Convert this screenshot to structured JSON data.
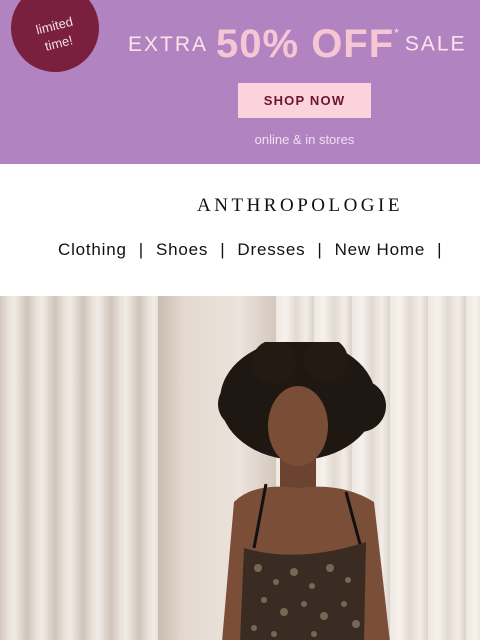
{
  "promo": {
    "badge_line1": "limited",
    "badge_line2": "time!",
    "extra": "EXTRA",
    "discount": "50% OFF",
    "asterisk": "*",
    "sale": "SALE",
    "cta": "SHOP NOW",
    "subline": "online & in stores",
    "colors": {
      "background": "#b184c1",
      "badge": "#7a1f3d",
      "button": "#fbd3dc"
    }
  },
  "brand": {
    "logo": "ANTHROPOLOGIE"
  },
  "nav": {
    "items": [
      {
        "label": "Clothing"
      },
      {
        "label": "Shoes"
      },
      {
        "label": "Dresses"
      },
      {
        "label": "New Home"
      }
    ],
    "separator": "|"
  },
  "hero": {
    "icon": "model-photo"
  }
}
